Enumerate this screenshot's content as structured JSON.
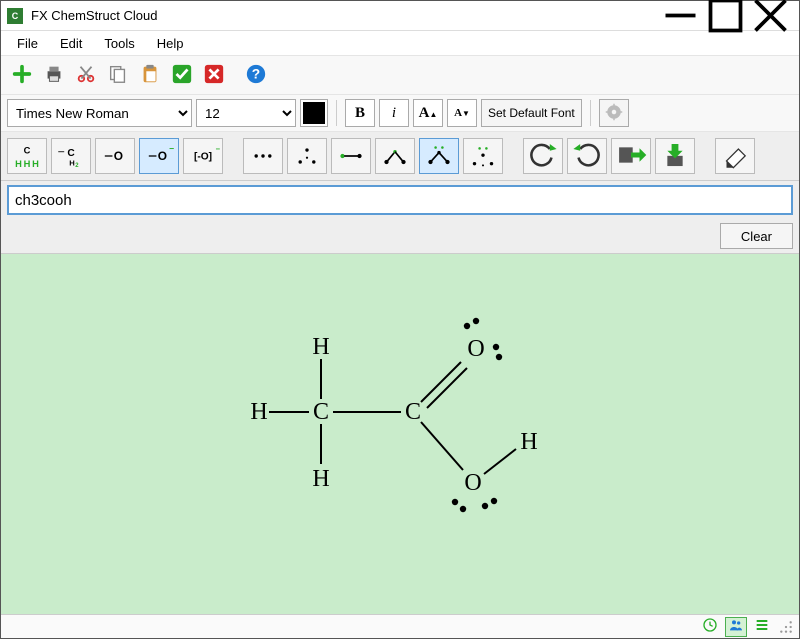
{
  "window": {
    "title": "FX ChemStruct Cloud"
  },
  "menubar": {
    "file": "File",
    "edit": "Edit",
    "tools": "Tools",
    "help": "Help"
  },
  "fontrow": {
    "font_name": "Times New Roman",
    "font_size": "12",
    "bold": "B",
    "italic": "i",
    "size_up": "A",
    "size_down": "A",
    "set_default": "Set Default Font"
  },
  "struct_tools": {
    "methane": "C",
    "methylene": "CH",
    "single_o": "O",
    "neg_o": "O",
    "bracket_o": "[-O]"
  },
  "formula_input": {
    "value": "ch3cooh"
  },
  "clear_button": "Clear",
  "colors": {
    "accent_green": "#27ae27",
    "canvas_bg": "#c9eccb",
    "selection_blue": "#5b9bd5"
  },
  "molecule": {
    "formula": "CH3COOH",
    "atoms": [
      "C",
      "C",
      "O",
      "O",
      "H",
      "H",
      "H",
      "H"
    ],
    "atom_labels": {
      "H1": "H",
      "H2": "H",
      "H3": "H",
      "C1": "C",
      "C2": "C",
      "O1": "O",
      "O2": "O",
      "H4": "H"
    }
  }
}
